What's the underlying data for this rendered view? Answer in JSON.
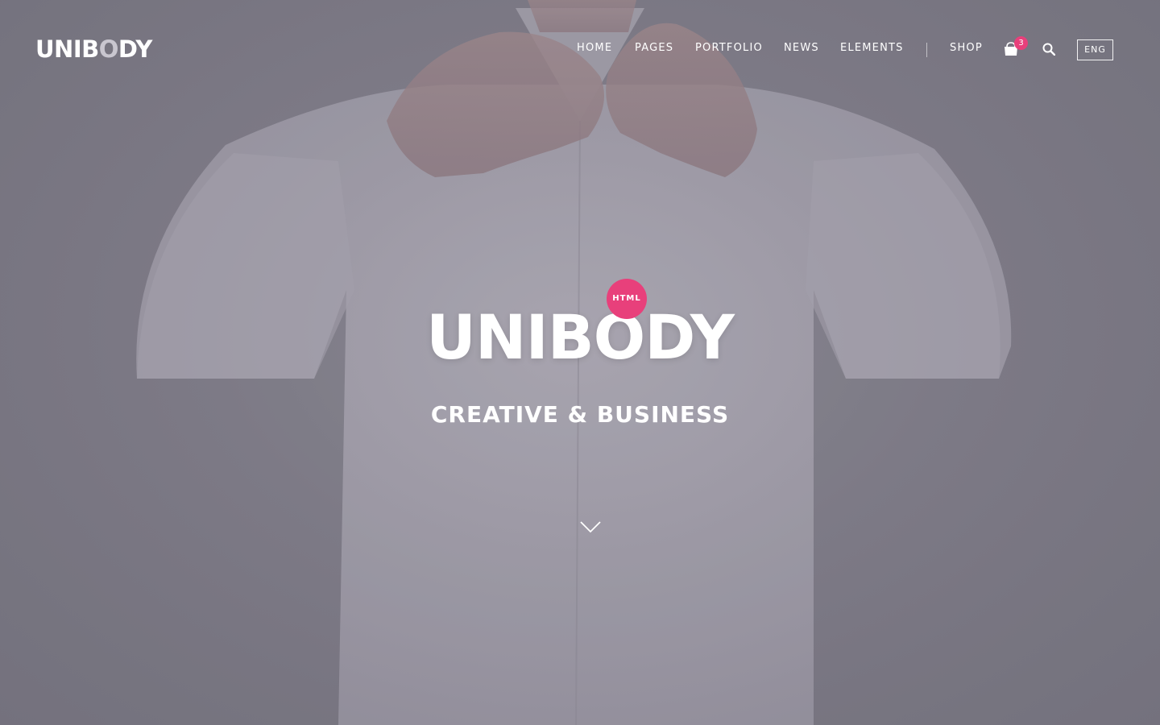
{
  "header": {
    "logo_prefix": "UNIB",
    "logo_o": "O",
    "logo_suffix": "DY",
    "nav": [
      "HOME",
      "PAGES",
      "PORTFOLIO",
      "NEWS",
      "ELEMENTS",
      "SHOP"
    ],
    "cart_count": "3",
    "language": "ENG"
  },
  "hero": {
    "badge": "HTML",
    "title": "UNIBODY",
    "subtitle": "CREATIVE & BUSINESS"
  },
  "colors": {
    "accent": "#e8407b",
    "overlay": "#7f7c88",
    "text": "#ffffff"
  },
  "icons": [
    "shopping-bag-icon",
    "search-icon",
    "chevron-down-icon"
  ]
}
